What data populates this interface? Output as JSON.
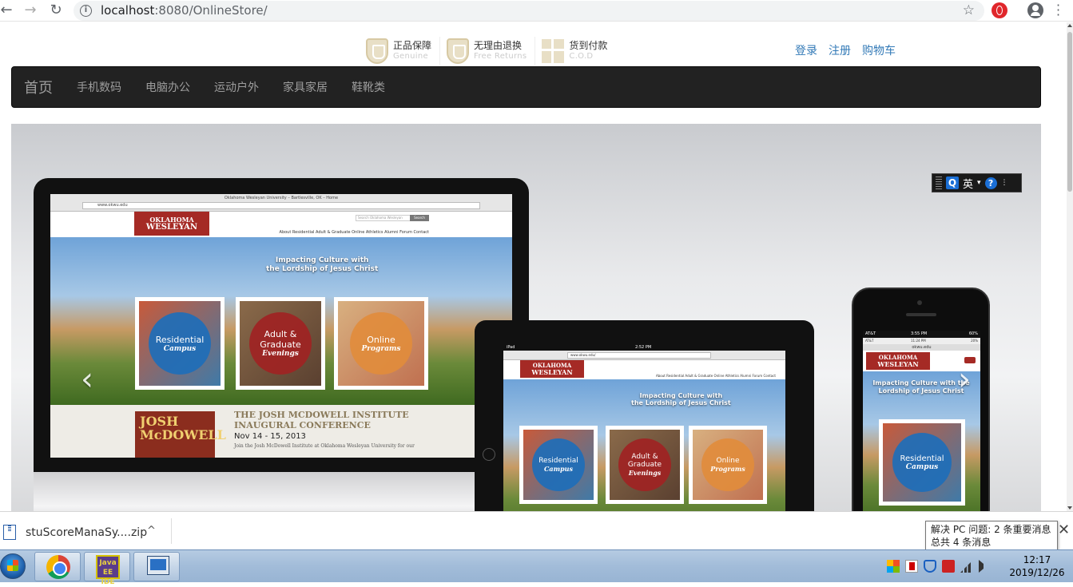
{
  "browser": {
    "url_host": "localhost",
    "url_rest": ":8080/OnlineStore/",
    "back_icon": "arrow-left-icon",
    "forward_icon": "arrow-right-icon",
    "reload_icon": "reload-icon",
    "star_icon": "star-icon"
  },
  "guarantees": [
    {
      "cn": "正品保障",
      "en": "Genuine"
    },
    {
      "cn": "无理由退换",
      "en": "Free Returns"
    },
    {
      "cn": "货到付款",
      "en": "C.O.D"
    }
  ],
  "toplinks": {
    "login": "登录",
    "register": "注册",
    "cart": "购物车"
  },
  "navbar": {
    "brand": "首页",
    "items": [
      "手机数码",
      "电脑办公",
      "运动户外",
      "家具家居",
      "鞋靴类"
    ]
  },
  "carousel": {
    "prev": "‹",
    "next": "›",
    "laptop": {
      "window_title": "Oklahoma Wesleyan University – Bartlesville, OK – Home",
      "url": "www.okwu.edu",
      "search_placeholder": "Search Oklahoma Wesleyan",
      "search_btn": "Search",
      "logo_line1": "OKLAHOMA",
      "logo_line2": "WESLEYAN",
      "menu": "About   Residential   Adult & Graduate   Online   Athletics   Alumni   Forum   Contact",
      "tagline1": "Impacting Culture with",
      "tagline2": "the Lordship of Jesus Christ",
      "tiles": [
        {
          "t1": "Residential",
          "t2": "Campus"
        },
        {
          "t1": "Adult &",
          "t1b": "Graduate",
          "t2": "Evenings"
        },
        {
          "t1": "Online",
          "t2": "Programs"
        }
      ],
      "book_line1": "JOSH",
      "book_line2": "McDOWELL",
      "news_title1": "THE JOSH MCDOWELL INSTITUTE",
      "news_title2": "INAUGURAL CONFERENCE",
      "news_date": "Nov 14 - 15, 2013",
      "news_body": "Join the Josh McDowell Institute at Oklahoma Wesleyan University for our"
    },
    "tablet": {
      "status": "iPad",
      "time": "2:52 PM",
      "url": "www.okwu.edu/",
      "tagline1": "Impacting Culture with",
      "tagline2": "the Lordship of Jesus Christ"
    },
    "phone": {
      "carrier": "AT&T",
      "time": "3:55 PM",
      "battery": "60%",
      "carrier2": "AT&T",
      "time2": "11:24 PM",
      "battery2": "20%",
      "url": "okwu.edu",
      "tagline": "Impacting Culture with the Lordship of Jesus Christ",
      "tile_t1": "Residential",
      "tile_t2": "Campus"
    }
  },
  "ime": {
    "lang": "英",
    "q": "Q",
    "help": "?"
  },
  "download": {
    "filename": "stuScoreManaSy....zip",
    "chevron": "^",
    "close": "✕"
  },
  "balloon": {
    "line1": "解决 PC 问题:  2 条重要消息",
    "line2": "总共 4 条消息"
  },
  "taskbar": {
    "jee_label": "Java EE IDE",
    "time": "12:17",
    "date": "2019/12/26"
  }
}
